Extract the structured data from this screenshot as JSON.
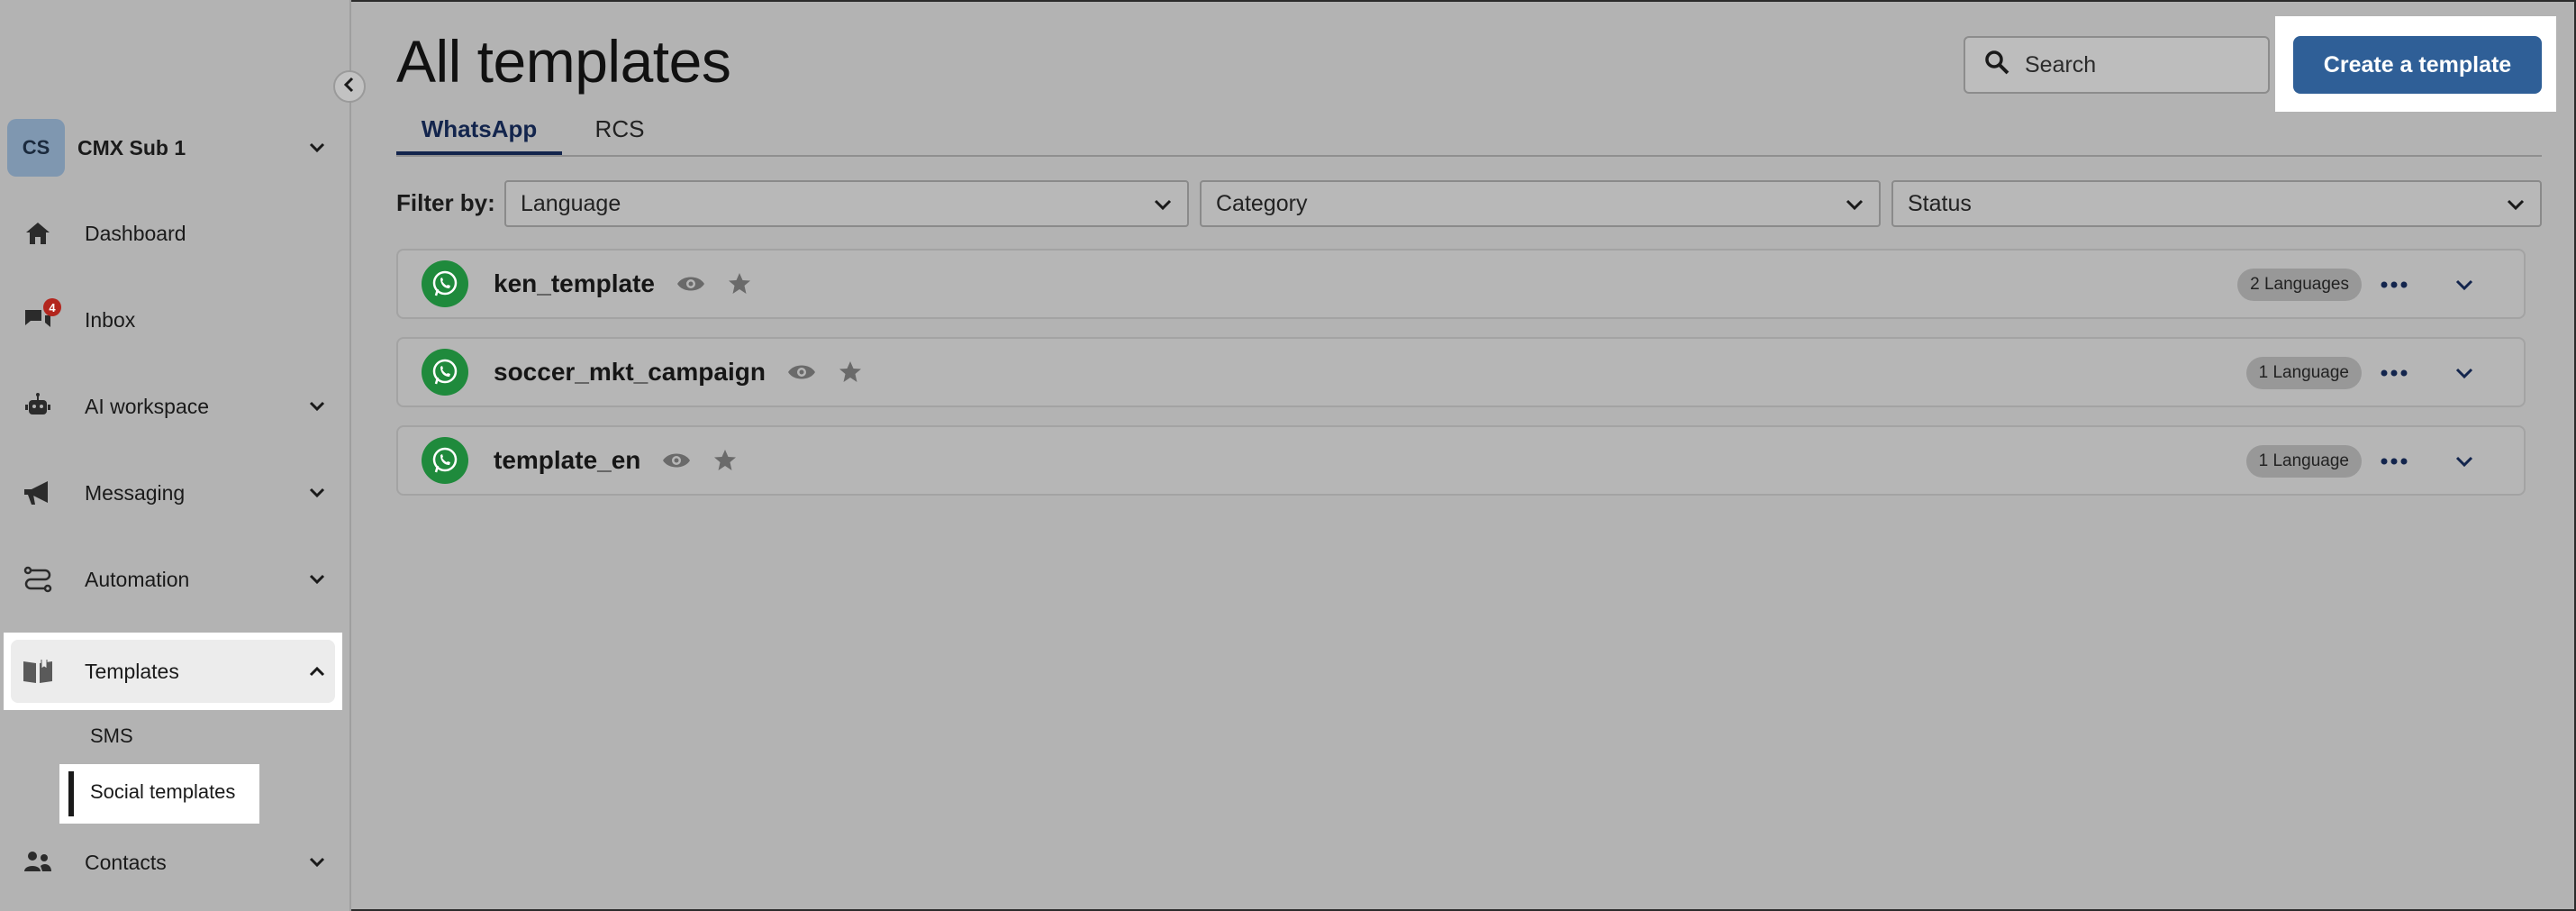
{
  "sidebar": {
    "account": {
      "initials": "CS",
      "name": "CMX Sub 1"
    },
    "items": [
      {
        "label": "Dashboard",
        "icon": "home-icon"
      },
      {
        "label": "Inbox",
        "icon": "chat-icon",
        "badge": "4"
      },
      {
        "label": "AI workspace",
        "icon": "robot-icon"
      },
      {
        "label": "Messaging",
        "icon": "megaphone-icon"
      },
      {
        "label": "Automation",
        "icon": "route-icon"
      },
      {
        "label": "Templates",
        "icon": "book-icon"
      },
      {
        "label": "Contacts",
        "icon": "people-icon"
      }
    ],
    "sub_items": [
      {
        "label": "SMS"
      },
      {
        "label": "Social templates"
      }
    ]
  },
  "header": {
    "title": "All templates",
    "search_placeholder": "Search",
    "create_label": "Create a template"
  },
  "tabs": [
    {
      "label": "WhatsApp",
      "active": true
    },
    {
      "label": "RCS",
      "active": false
    }
  ],
  "filters": {
    "label": "Filter by:",
    "language": "Language",
    "category": "Category",
    "status": "Status"
  },
  "templates": [
    {
      "name": "ken_template",
      "languages": "2 Languages"
    },
    {
      "name": "soccer_mkt_campaign",
      "languages": "1 Language"
    },
    {
      "name": "template_en",
      "languages": "1 Language"
    }
  ],
  "colors": {
    "primary": "#2f5f97",
    "whatsapp": "#1f8a3c",
    "badge": "#b3261e",
    "tab_active": "#13254d"
  }
}
